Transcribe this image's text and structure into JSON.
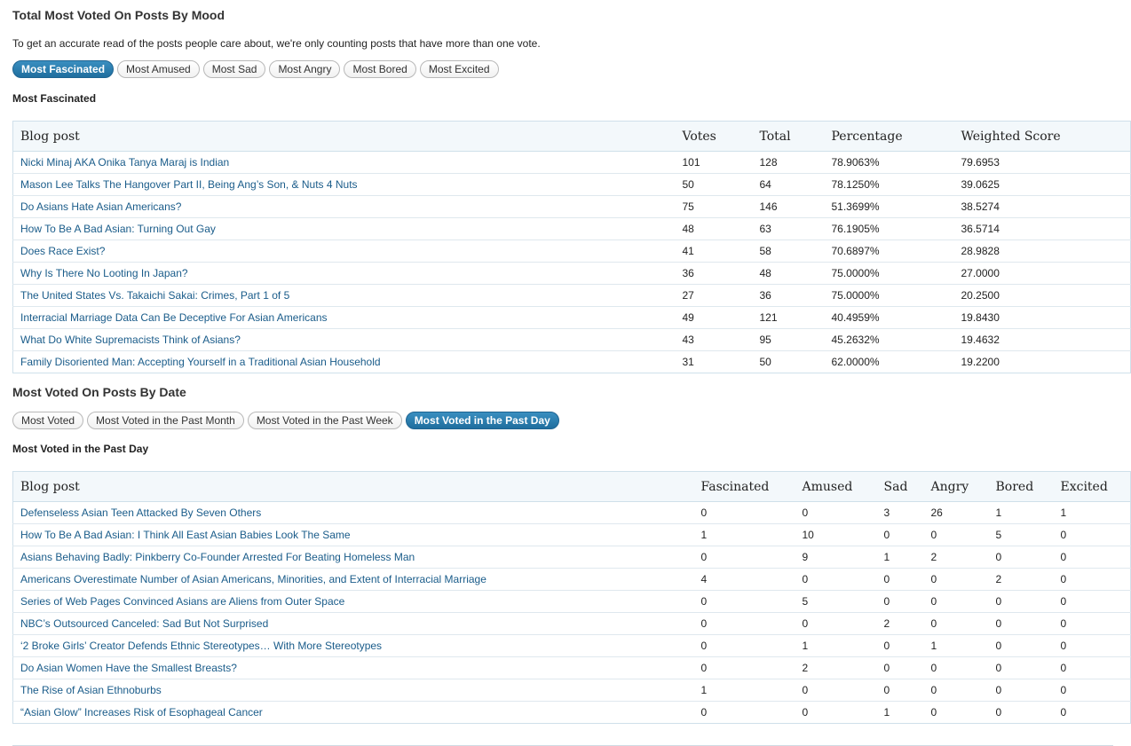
{
  "mood_section": {
    "title": "Total Most Voted On Posts By Mood",
    "intro": "To get an accurate read of the posts people care about, we're only counting posts that have more than one vote.",
    "tabs": [
      "Most Fascinated",
      "Most Amused",
      "Most Sad",
      "Most Angry",
      "Most Bored",
      "Most Excited"
    ],
    "active_tab": "Most Fascinated",
    "subheading": "Most Fascinated",
    "columns": [
      "Blog post",
      "Votes",
      "Total",
      "Percentage",
      "Weighted Score"
    ],
    "rows": [
      [
        "Nicki Minaj AKA Onika Tanya Maraj is Indian",
        "101",
        "128",
        "78.9063%",
        "79.6953"
      ],
      [
        "Mason Lee Talks The Hangover Part II, Being Ang’s Son, & Nuts 4 Nuts",
        "50",
        "64",
        "78.1250%",
        "39.0625"
      ],
      [
        "Do Asians Hate Asian Americans?",
        "75",
        "146",
        "51.3699%",
        "38.5274"
      ],
      [
        "How To Be A Bad Asian: Turning Out Gay",
        "48",
        "63",
        "76.1905%",
        "36.5714"
      ],
      [
        "Does Race Exist?",
        "41",
        "58",
        "70.6897%",
        "28.9828"
      ],
      [
        "Why Is There No Looting In Japan?",
        "36",
        "48",
        "75.0000%",
        "27.0000"
      ],
      [
        "The United States Vs. Takaichi Sakai: Crimes, Part 1 of 5",
        "27",
        "36",
        "75.0000%",
        "20.2500"
      ],
      [
        "Interracial Marriage Data Can Be Deceptive For Asian Americans",
        "49",
        "121",
        "40.4959%",
        "19.8430"
      ],
      [
        "What Do White Supremacists Think of Asians?",
        "43",
        "95",
        "45.2632%",
        "19.4632"
      ],
      [
        "Family Disoriented Man: Accepting Yourself in a Traditional Asian Household",
        "31",
        "50",
        "62.0000%",
        "19.2200"
      ]
    ]
  },
  "date_section": {
    "title": "Most Voted On Posts By Date",
    "tabs": [
      "Most Voted",
      "Most Voted in the Past Month",
      "Most Voted in the Past Week",
      "Most Voted in the Past Day"
    ],
    "active_tab": "Most Voted in the Past Day",
    "subheading": "Most Voted in the Past Day",
    "columns": [
      "Blog post",
      "Fascinated",
      "Amused",
      "Sad",
      "Angry",
      "Bored",
      "Excited"
    ],
    "rows": [
      [
        "Defenseless Asian Teen Attacked By Seven Others",
        "0",
        "0",
        "3",
        "26",
        "1",
        "1"
      ],
      [
        "How To Be A Bad Asian: I Think All East Asian Babies Look The Same",
        "1",
        "10",
        "0",
        "0",
        "5",
        "0"
      ],
      [
        "Asians Behaving Badly: Pinkberry Co-Founder Arrested For Beating Homeless Man",
        "0",
        "9",
        "1",
        "2",
        "0",
        "0"
      ],
      [
        "Americans Overestimate Number of Asian Americans, Minorities, and Extent of Interracial Marriage",
        "4",
        "0",
        "0",
        "0",
        "2",
        "0"
      ],
      [
        "Series of Web Pages Convinced Asians are Aliens from Outer Space",
        "0",
        "5",
        "0",
        "0",
        "0",
        "0"
      ],
      [
        "NBC’s Outsourced Canceled: Sad But Not Surprised",
        "0",
        "0",
        "2",
        "0",
        "0",
        "0"
      ],
      [
        "‘2 Broke Girls’ Creator Defends Ethnic Stereotypes… With More Stereotypes",
        "0",
        "1",
        "0",
        "1",
        "0",
        "0"
      ],
      [
        "Do Asian Women Have the Smallest Breasts?",
        "0",
        "2",
        "0",
        "0",
        "0",
        "0"
      ],
      [
        "The Rise of Asian Ethnoburbs",
        "1",
        "0",
        "0",
        "0",
        "0",
        "0"
      ],
      [
        "“Asian Glow” Increases Risk of Esophageal Cancer",
        "0",
        "0",
        "1",
        "0",
        "0",
        "0"
      ]
    ]
  },
  "colors": {
    "accent": "#1f6e9e",
    "link": "#1a5c8a",
    "table_header_bg": "#f3f8fb",
    "table_border": "#cfe0ea"
  }
}
